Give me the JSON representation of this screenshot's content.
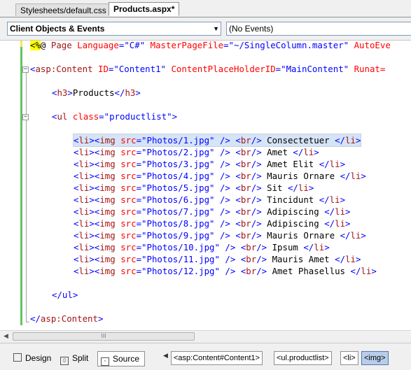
{
  "tabs": [
    {
      "label": "Stylesheets/default.css",
      "active": false
    },
    {
      "label": "Products.aspx*",
      "active": true
    }
  ],
  "dropdowns": {
    "objects": "Client Objects & Events",
    "events": "(No Events)"
  },
  "code": {
    "l1": {
      "dir_open": "<%",
      "at": "@",
      "rest_pre": " ",
      "page": "Page",
      "a1": "Language",
      "v1": "\"C#\"",
      "a2": "MasterPageFile",
      "v2": "\"~/SingleColumn.master\"",
      "a3": "AutoEve"
    },
    "l2": {
      "lt": "<",
      "el": "asp:Content",
      "a1": "ID",
      "v1": "\"Content1\"",
      "a2": "ContentPlaceHolderID",
      "v2": "\"MainContent\"",
      "a3": "Runat="
    },
    "l3": {
      "open": "<",
      "el": "h3",
      "close": ">",
      "text": "Products",
      "open2": "</",
      "el2": "h3",
      "close2": ">"
    },
    "l4": {
      "open": "<",
      "el": "ul",
      "attr": "class",
      "eq": "=",
      "val": "\"productlist\"",
      "close": ">"
    },
    "items": [
      {
        "n": "1",
        "name": "Consectetuer"
      },
      {
        "n": "2",
        "name": "Amet"
      },
      {
        "n": "3",
        "name": "Amet Elit"
      },
      {
        "n": "4",
        "name": "Mauris Ornare"
      },
      {
        "n": "5",
        "name": "Sit"
      },
      {
        "n": "6",
        "name": "Tincidunt"
      },
      {
        "n": "7",
        "name": "Adipiscing"
      },
      {
        "n": "8",
        "name": "Adipiscing"
      },
      {
        "n": "9",
        "name": "Mauris Ornare"
      },
      {
        "n": "10",
        "name": "Ipsum"
      },
      {
        "n": "11",
        "name": "Mauris Amet"
      },
      {
        "n": "12",
        "name": "Amet Phasellus"
      }
    ],
    "ul_close": "</ul>",
    "content_close": "</asp:Content>"
  },
  "scroll": {
    "thumb": "III"
  },
  "views": {
    "design": "Design",
    "split": "Split",
    "source": "Source"
  },
  "breadcrumbs": [
    "<asp:Content#Content1>",
    "<ul.productlist>",
    "<li>",
    "<img>"
  ]
}
